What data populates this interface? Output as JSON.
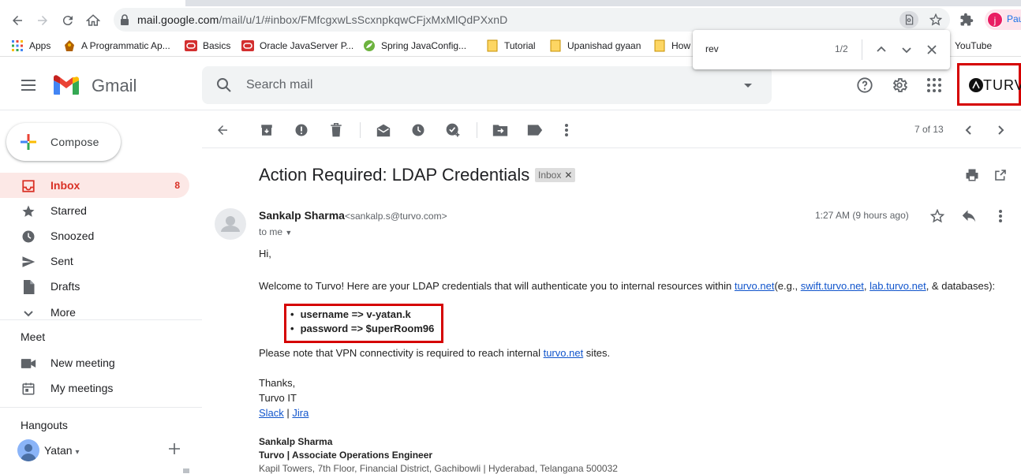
{
  "browser": {
    "url_host": "mail.google.com",
    "url_path": "/mail/u/1/#inbox/FMfcgxwLsScxnpkqwCFjxMxMlQdPXxnD",
    "profile_initial": "j",
    "profile_name": "Pau",
    "bookmarks": [
      {
        "label": "Apps",
        "icon": "apps-grid-icon"
      },
      {
        "label": "A Programmatic Ap...",
        "icon": "bookmark-favicon"
      },
      {
        "label": "Basics",
        "icon": "oracle-icon"
      },
      {
        "label": "Oracle JavaServer P...",
        "icon": "oracle-icon"
      },
      {
        "label": "Spring JavaConfig...",
        "icon": "spring-icon"
      },
      {
        "label": "Tutorial",
        "icon": "folder-icon"
      },
      {
        "label": "Upanishad gyaan",
        "icon": "folder-icon"
      },
      {
        "label": "How",
        "icon": "folder-icon"
      },
      {
        "label": "YouTube",
        "icon": "youtube-icon"
      }
    ],
    "find": {
      "query": "rev",
      "count": "1/2"
    }
  },
  "gmail": {
    "logo_text": "Gmail",
    "search_placeholder": "Search mail",
    "brand": "TURVO",
    "compose_label": "Compose",
    "nav": [
      {
        "label": "Inbox",
        "count": "8",
        "icon": "inbox-icon"
      },
      {
        "label": "Starred",
        "count": "",
        "icon": "star-icon"
      },
      {
        "label": "Snoozed",
        "count": "",
        "icon": "clock-icon"
      },
      {
        "label": "Sent",
        "count": "",
        "icon": "send-icon"
      },
      {
        "label": "Drafts",
        "count": "",
        "icon": "draft-icon"
      },
      {
        "label": "More",
        "count": "",
        "icon": "chevron-down-icon"
      }
    ],
    "meet": {
      "title": "Meet",
      "new_meeting": "New meeting",
      "my_meetings": "My meetings"
    },
    "hangouts": {
      "title": "Hangouts",
      "user": "Yatan"
    },
    "pager": "7 of 13"
  },
  "email": {
    "subject": "Action Required: LDAP Credentials",
    "label_chip": "Inbox",
    "sender_name": "Sankalp Sharma",
    "sender_email": "<sankalp.s@turvo.com>",
    "to": "to me",
    "time": "1:27 AM (9 hours ago)",
    "greeting": "Hi,",
    "welcome_pre": "Welcome to Turvo! Here are your LDAP credentials that will authenticate you to internal resources within ",
    "link_turvo": "turvo.net",
    "welcome_mid1": "(e.g., ",
    "link_swift": "swift.turvo.net",
    "comma": ", ",
    "link_lab": "lab.turvo.net",
    "welcome_end": ", & databases):",
    "credentials": [
      "username => v-yatan.k",
      "password => $uperRoom96"
    ],
    "vpn_pre": "Please note that VPN connectivity is required to reach internal ",
    "vpn_link": "turvo.net",
    "vpn_post": " sites.",
    "thanks": "Thanks,",
    "team": "Turvo IT",
    "link_slack": "Slack",
    "pipe": " | ",
    "link_jira": "Jira",
    "sig_name": "Sankalp Sharma",
    "sig_title": "Turvo | Associate Operations Engineer",
    "sig_address": "Kapil Towers, 7th Floor, Financial District, Gachibowli | Hyderabad, Telangana 500032"
  },
  "colors": {
    "accent_red": "#d93025",
    "highlight_box": "#d50000",
    "link": "#1155cc"
  }
}
